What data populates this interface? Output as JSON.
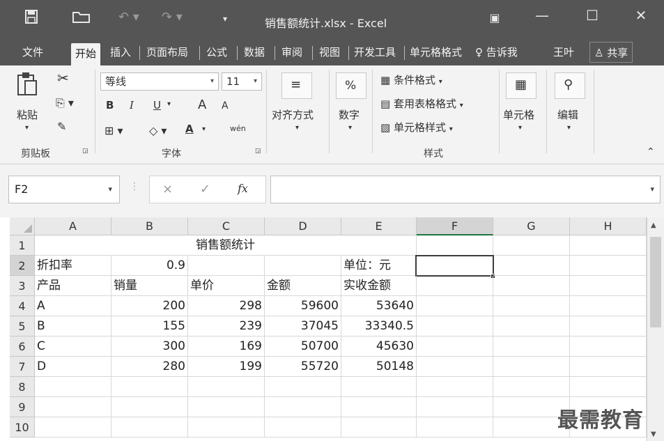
{
  "titlebar": {
    "document_title": "销售额统计.xlsx - Excel",
    "save_icon": "save-icon",
    "open_icon": "folder-icon"
  },
  "tabs": [
    "文件",
    "开始",
    "插入",
    "页面布局",
    "公式",
    "数据",
    "审阅",
    "视图",
    "开发工具",
    "单元格格式"
  ],
  "tell_me": "告诉我",
  "user": "王叶",
  "share": "共享",
  "ribbon": {
    "clipboard": {
      "paste": "粘贴",
      "group_label": "剪贴板"
    },
    "font": {
      "font_name": "等线",
      "font_size": "11",
      "bold": "B",
      "italic": "I",
      "underline": "U",
      "grow": "A",
      "shrink": "A",
      "color_a": "A",
      "phonetic": "wén",
      "group_label": "字体"
    },
    "alignment": {
      "label": "对齐方式"
    },
    "number": {
      "symbol": "%",
      "label": "数字"
    },
    "styles": {
      "conditional": "条件格式",
      "table": "套用表格格式",
      "cell_styles": "单元格样式",
      "group_label": "样式"
    },
    "cells": {
      "label": "单元格"
    },
    "editing": {
      "label": "编辑"
    }
  },
  "formula_bar": {
    "name_box": "F2",
    "cancel": "×",
    "enter": "✓",
    "fx": "fx",
    "content": ""
  },
  "sheet": {
    "columns": [
      "A",
      "B",
      "C",
      "D",
      "E",
      "F",
      "G",
      "H"
    ],
    "selected_column": "F",
    "rows": [
      "1",
      "2",
      "3",
      "4",
      "5",
      "6",
      "7",
      "8",
      "9",
      "10"
    ],
    "selected_row": "2",
    "title": "销售额统计",
    "discount_label": "折扣率",
    "discount_value": "0.9",
    "unit_label": "单位：元",
    "headers": [
      "产品",
      "销量",
      "单价",
      "金额",
      "实收金额"
    ],
    "data": [
      [
        "A",
        "200",
        "298",
        "59600",
        "53640"
      ],
      [
        "B",
        "155",
        "239",
        "37045",
        "33340.5"
      ],
      [
        "C",
        "300",
        "169",
        "50700",
        "45630"
      ],
      [
        "D",
        "280",
        "199",
        "55720",
        "50148"
      ]
    ]
  },
  "watermark": "最需教育"
}
